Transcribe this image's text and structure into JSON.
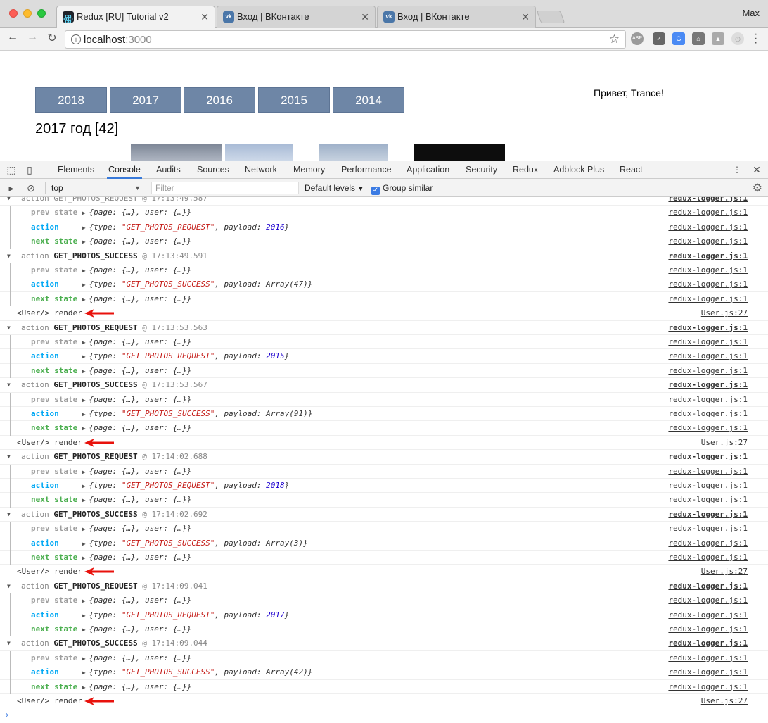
{
  "browser": {
    "tabs": [
      {
        "title": "Redux [RU] Tutorial v2",
        "active": true,
        "icon": "react-icon"
      },
      {
        "title": "Вход | ВКонтакте",
        "active": false,
        "icon": "vk-icon"
      },
      {
        "title": "Вход | ВКонтакте",
        "active": false,
        "icon": "vk-icon"
      }
    ],
    "profile": "Max",
    "url_host": "localhost",
    "url_port": ":3000",
    "extensions": [
      "ABP",
      "pocket",
      "translate",
      "shoe",
      "drive",
      "clock"
    ]
  },
  "page": {
    "years": [
      "2018",
      "2017",
      "2016",
      "2015",
      "2014"
    ],
    "greeting": "Привет, Trance!",
    "heading": "2017 год [42]"
  },
  "devtools": {
    "tabs": [
      "Elements",
      "Console",
      "Audits",
      "Sources",
      "Network",
      "Memory",
      "Performance",
      "Application",
      "Security",
      "Redux",
      "Adblock Plus",
      "React"
    ],
    "active_tab": "Console",
    "context": "top",
    "filter_placeholder": "Filter",
    "levels": "Default levels",
    "group_similar": "Group similar"
  },
  "console": {
    "logger_src": "redux-logger.js:1",
    "user_src": "User.js:27",
    "user_msg": "<User/> render",
    "prev_label": "prev state",
    "action_label": "action",
    "next_label": "next state",
    "state_text": "{page: {…}, user: {…}}",
    "first_partial": "action GET_PHOTOS_REQUEST @ 17:13:49.587",
    "groups": [
      {
        "name": "GET_PHOTOS_SUCCESS",
        "time": "@ 17:13:49.591",
        "type": "\"GET_PHOTOS_SUCCESS\"",
        "payload": "Array(47)",
        "payload_kind": "plain"
      },
      {
        "name": "GET_PHOTOS_REQUEST",
        "time": "@ 17:13:53.563",
        "type": "\"GET_PHOTOS_REQUEST\"",
        "payload": "2015",
        "payload_kind": "num"
      },
      {
        "name": "GET_PHOTOS_SUCCESS",
        "time": "@ 17:13:53.567",
        "type": "\"GET_PHOTOS_SUCCESS\"",
        "payload": "Array(91)",
        "payload_kind": "plain"
      },
      {
        "name": "GET_PHOTOS_REQUEST",
        "time": "@ 17:14:02.688",
        "type": "\"GET_PHOTOS_REQUEST\"",
        "payload": "2018",
        "payload_kind": "num"
      },
      {
        "name": "GET_PHOTOS_SUCCESS",
        "time": "@ 17:14:02.692",
        "type": "\"GET_PHOTOS_SUCCESS\"",
        "payload": "Array(3)",
        "payload_kind": "plain"
      },
      {
        "name": "GET_PHOTOS_REQUEST",
        "time": "@ 17:14:09.041",
        "type": "\"GET_PHOTOS_REQUEST\"",
        "payload": "2017",
        "payload_kind": "num"
      },
      {
        "name": "GET_PHOTOS_SUCCESS",
        "time": "@ 17:14:09.044",
        "type": "\"GET_PHOTOS_SUCCESS\"",
        "payload": "Array(42)",
        "payload_kind": "plain"
      }
    ],
    "first_group_payload": "2016",
    "first_group_type": "\"GET_PHOTOS_REQUEST\""
  }
}
